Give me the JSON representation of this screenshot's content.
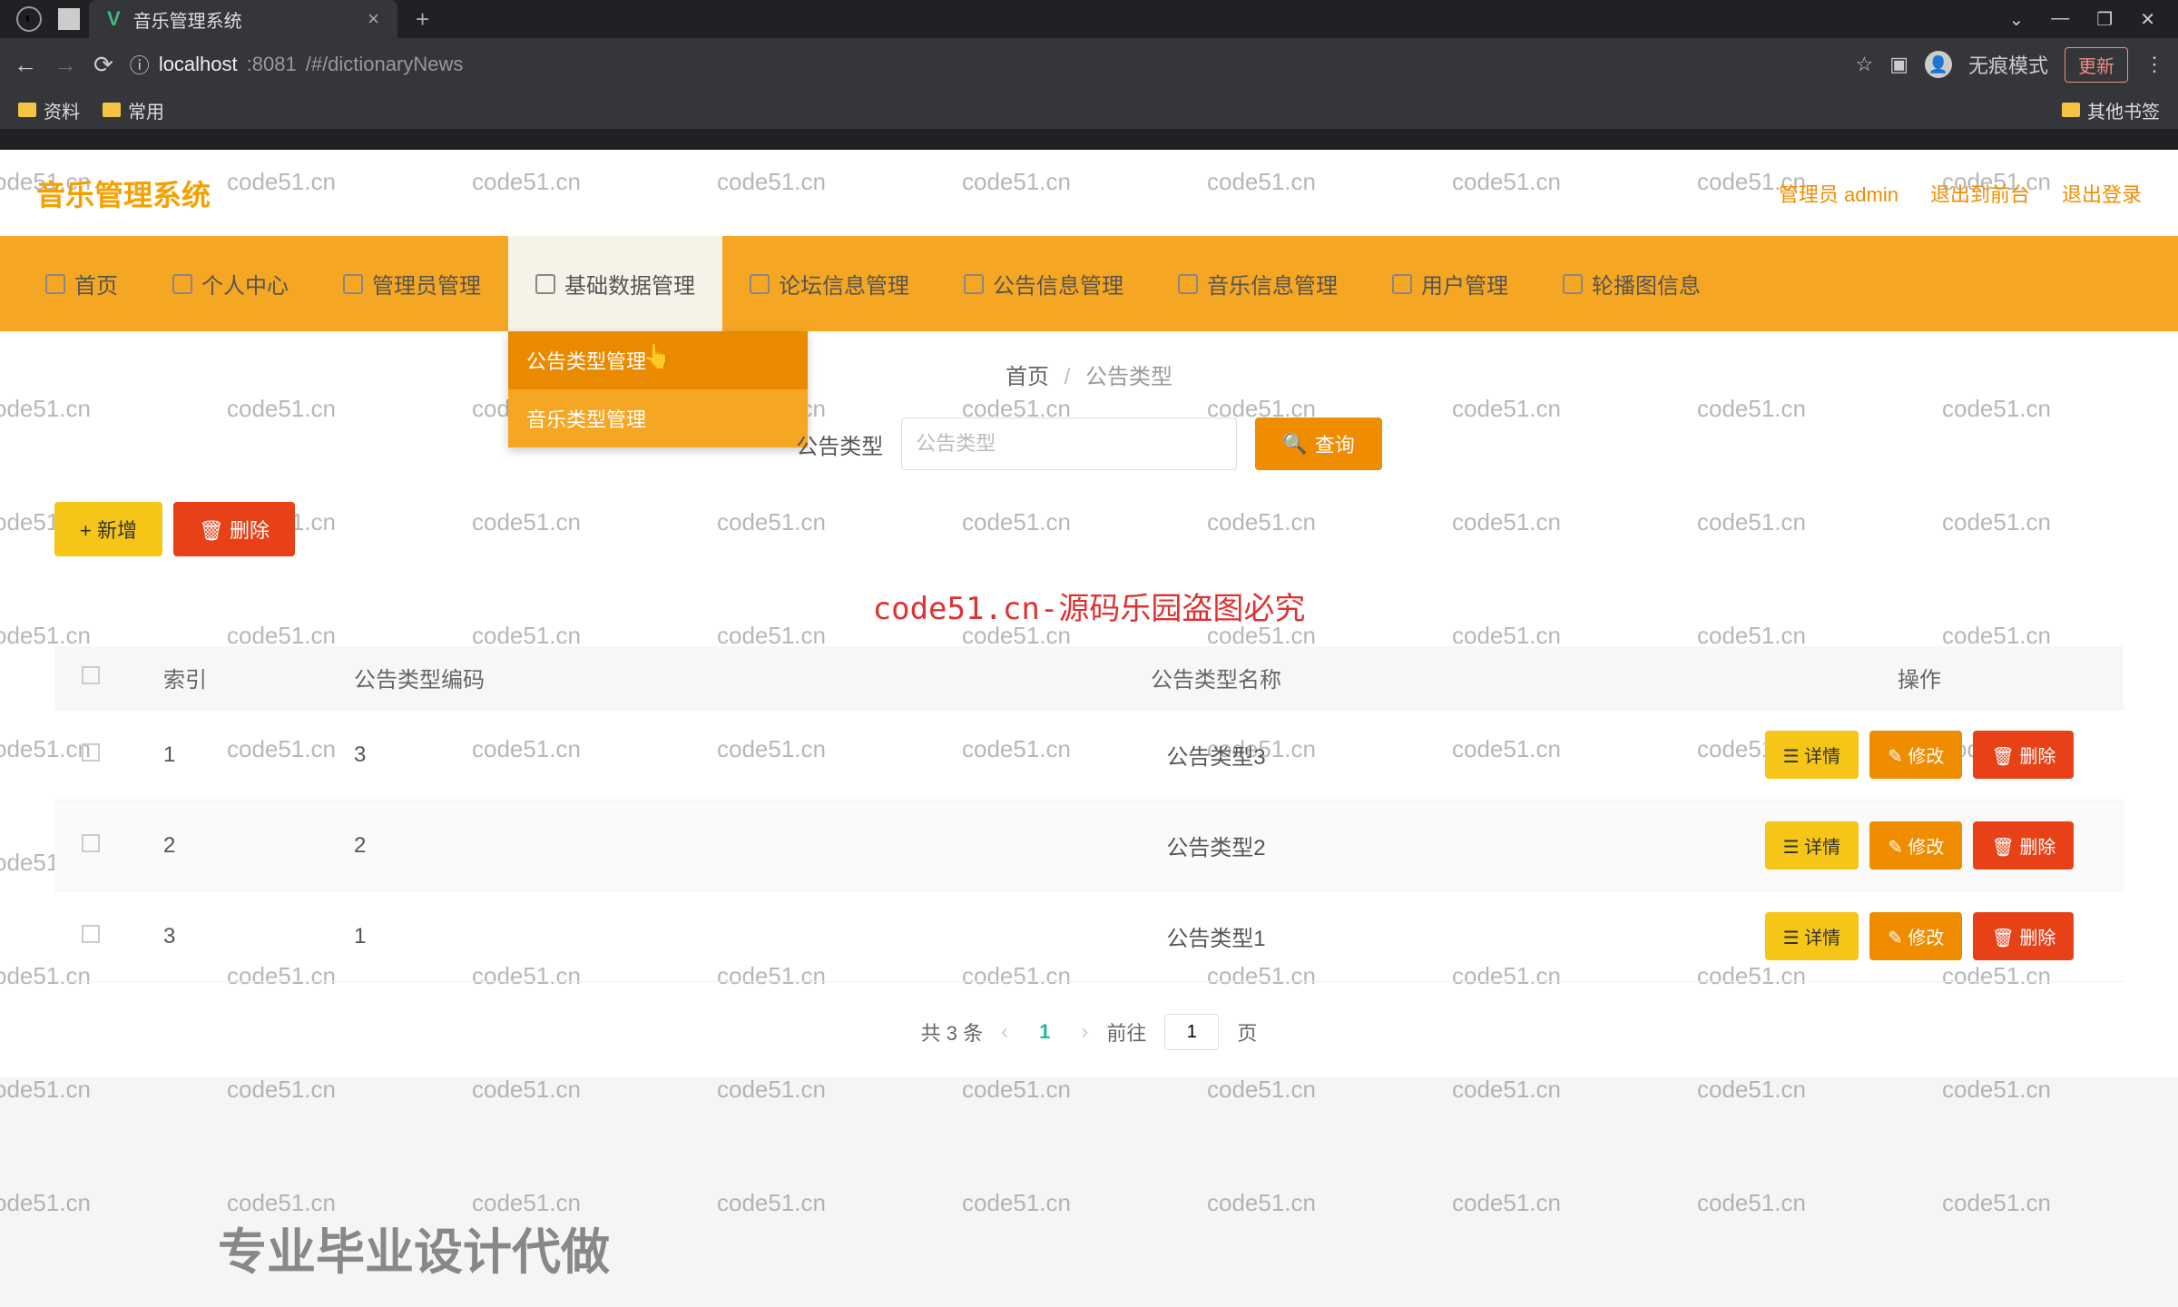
{
  "browser": {
    "tab_title": "音乐管理系统",
    "url_host": "localhost",
    "url_port": ":8081",
    "url_path": "/#/dictionaryNews",
    "incognito_label": "无痕模式",
    "update_label": "更新",
    "bookmarks": [
      "资料",
      "常用"
    ],
    "bookmarks_other": "其他书签"
  },
  "header": {
    "title": "音乐管理系统",
    "user": "管理员 admin",
    "link_front": "退出到前台",
    "link_logout": "退出登录"
  },
  "nav": {
    "items": [
      "首页",
      "个人中心",
      "管理员管理",
      "基础数据管理",
      "论坛信息管理",
      "公告信息管理",
      "音乐信息管理",
      "用户管理",
      "轮播图信息"
    ],
    "active_index": 3,
    "dropdown": [
      "公告类型管理",
      "音乐类型管理"
    ]
  },
  "breadcrumb": {
    "home": "首页",
    "current": "公告类型"
  },
  "search": {
    "label": "公告类型",
    "placeholder": "公告类型",
    "button": "查询"
  },
  "actions": {
    "add": "+ 新增",
    "delete": "删除"
  },
  "watermark_main": "code51.cn-源码乐园盗图必究",
  "watermark_bg": "code51.cn",
  "table": {
    "headers": {
      "index": "索引",
      "code": "公告类型编码",
      "name": "公告类型名称",
      "ops": "操作"
    },
    "rows": [
      {
        "index": "1",
        "code": "3",
        "name": "公告类型3"
      },
      {
        "index": "2",
        "code": "2",
        "name": "公告类型2"
      },
      {
        "index": "3",
        "code": "1",
        "name": "公告类型1"
      }
    ],
    "row_buttons": {
      "detail": "详情",
      "edit": "修改",
      "delete": "删除"
    }
  },
  "pagination": {
    "total": "共 3 条",
    "current": "1",
    "goto_prefix": "前往",
    "goto_value": "1",
    "goto_suffix": "页"
  },
  "footer_ad": "专业毕业设计代做"
}
